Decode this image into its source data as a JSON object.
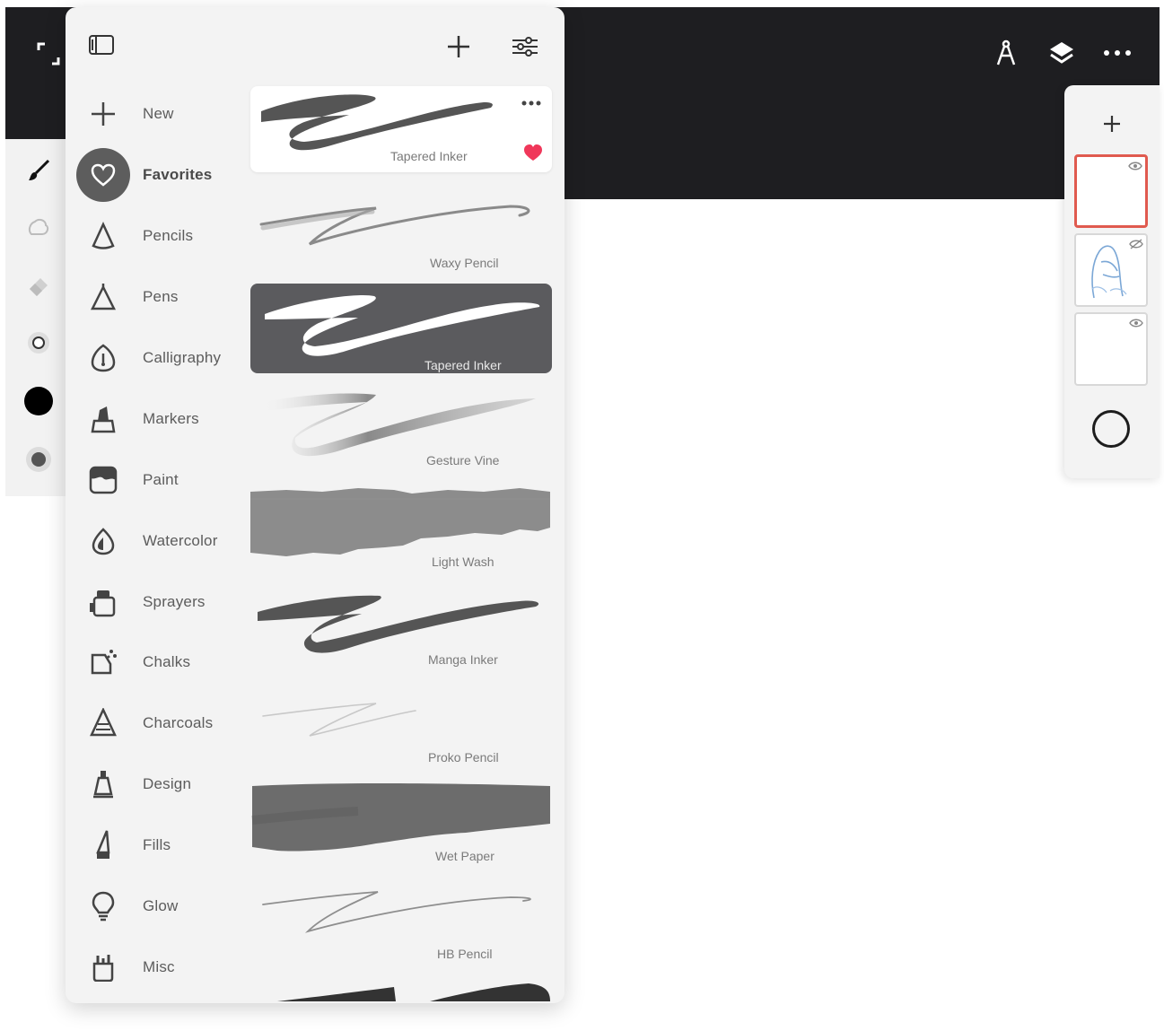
{
  "colors": {
    "topbar": "#1e1e21",
    "panel": "#f3f3f3",
    "selected_brush": "#5b5b5e",
    "favorite_heart": "#f0375a",
    "active_layer_border": "#e05a4f",
    "current_color": "#000000"
  },
  "topbar": {
    "left_icon": "expand-icon",
    "right_icons": [
      "compass-icon",
      "layers-icon",
      "more-icon"
    ]
  },
  "left_toolbar": {
    "tools": [
      "brush-icon",
      "smudge-icon",
      "eraser-icon",
      "brush-size-icon",
      "color-swatch",
      "opacity-icon"
    ]
  },
  "brush_panel": {
    "header_icons": [
      "sidebar-toggle-icon",
      "plus-icon",
      "sliders-icon"
    ],
    "categories": [
      {
        "label": "New",
        "icon": "plus-icon"
      },
      {
        "label": "Favorites",
        "icon": "heart-icon",
        "active": true
      },
      {
        "label": "Pencils",
        "icon": "pencil-icon"
      },
      {
        "label": "Pens",
        "icon": "pen-icon"
      },
      {
        "label": "Calligraphy",
        "icon": "calligraphy-icon"
      },
      {
        "label": "Markers",
        "icon": "marker-icon"
      },
      {
        "label": "Paint",
        "icon": "paint-icon"
      },
      {
        "label": "Watercolor",
        "icon": "watercolor-icon"
      },
      {
        "label": "Sprayers",
        "icon": "sprayer-icon"
      },
      {
        "label": "Chalks",
        "icon": "chalk-icon"
      },
      {
        "label": "Charcoals",
        "icon": "charcoal-icon"
      },
      {
        "label": "Design",
        "icon": "design-icon"
      },
      {
        "label": "Fills",
        "icon": "fill-icon"
      },
      {
        "label": "Glow",
        "icon": "glow-icon"
      },
      {
        "label": "Misc",
        "icon": "misc-icon"
      }
    ],
    "brushes": [
      {
        "name": "Tapered Inker",
        "favorited": true
      },
      {
        "name": "Waxy Pencil"
      },
      {
        "name": "Tapered Inker",
        "selected": true
      },
      {
        "name": "Gesture Vine"
      },
      {
        "name": "Light Wash"
      },
      {
        "name": "Manga Inker"
      },
      {
        "name": "Proko Pencil"
      },
      {
        "name": "Wet Paper"
      },
      {
        "name": "HB Pencil"
      }
    ]
  },
  "layers_panel": {
    "add_icon": "plus-icon",
    "layers": [
      {
        "active": true,
        "visible": true
      },
      {
        "active": false,
        "visible": false
      },
      {
        "active": false,
        "visible": true
      }
    ]
  }
}
